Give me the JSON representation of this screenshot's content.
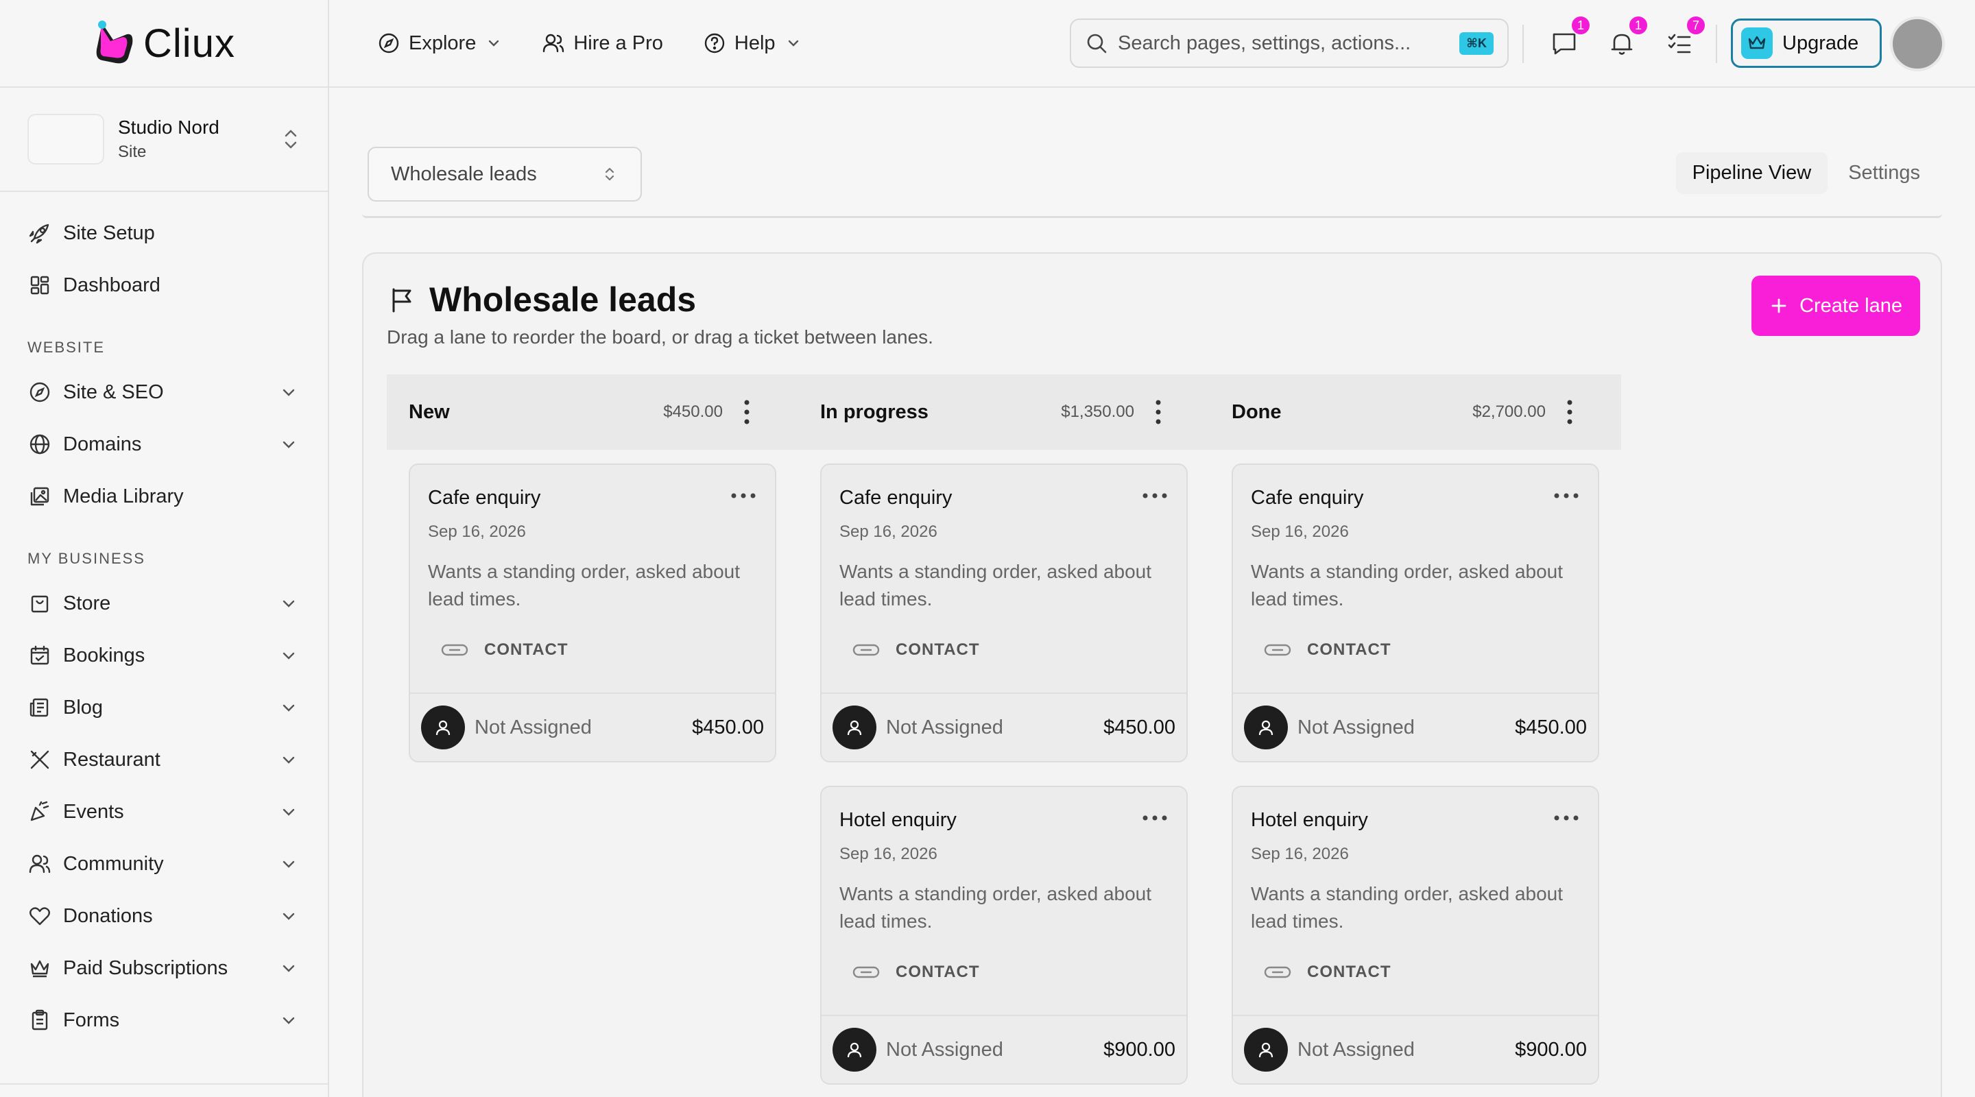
{
  "app": {
    "name": "Cliux"
  },
  "site": {
    "name": "Studio Nord",
    "type": "Site"
  },
  "sidebar": {
    "top_items": [
      {
        "label": "Site Setup",
        "icon": "rocket-icon"
      },
      {
        "label": "Dashboard",
        "icon": "dashboard-icon"
      }
    ],
    "sections": [
      {
        "title": "WEBSITE",
        "items": [
          {
            "label": "Site & SEO",
            "icon": "compass-icon"
          },
          {
            "label": "Domains",
            "icon": "globe-icon"
          },
          {
            "label": "Media Library",
            "icon": "media-icon"
          }
        ]
      },
      {
        "title": "MY BUSINESS",
        "items": [
          {
            "label": "Store",
            "icon": "store-icon"
          },
          {
            "label": "Bookings",
            "icon": "calendar-icon"
          },
          {
            "label": "Blog",
            "icon": "blog-icon"
          },
          {
            "label": "Restaurant",
            "icon": "utensils-icon"
          },
          {
            "label": "Events",
            "icon": "party-icon"
          },
          {
            "label": "Community",
            "icon": "users-icon"
          },
          {
            "label": "Donations",
            "icon": "heart-icon"
          },
          {
            "label": "Paid Subscriptions",
            "icon": "crown-icon"
          },
          {
            "label": "Forms",
            "icon": "clipboard-icon"
          }
        ]
      }
    ]
  },
  "header": {
    "nav": [
      {
        "label": "Explore",
        "icon": "compass-icon",
        "dropdown": true
      },
      {
        "label": "Hire a Pro",
        "icon": "users-icon",
        "dropdown": false
      },
      {
        "label": "Help",
        "icon": "help-icon",
        "dropdown": true
      }
    ],
    "search": {
      "placeholder": "Search pages, settings, actions...",
      "shortcut": "⌘K"
    },
    "badges": {
      "messages": "1",
      "notifications": "1",
      "tasks": "7"
    },
    "upgrade_label": "Upgrade"
  },
  "board": {
    "selected": "Wholesale leads",
    "tabs": [
      "Pipeline View",
      "Settings"
    ],
    "active_tab": "Pipeline View",
    "title": "Wholesale leads",
    "subtitle": "Drag a lane to reorder the board, or drag a ticket between lanes.",
    "create_label": "Create lane",
    "lanes": [
      {
        "name": "New",
        "total": "$450.00",
        "cards": [
          {
            "title": "Cafe enquiry",
            "date": "Sep 16, 2026",
            "desc": "Wants a standing order, asked about lead times.",
            "tag": "CONTACT",
            "assignee": "Not Assigned",
            "amount": "$450.00"
          }
        ]
      },
      {
        "name": "In progress",
        "total": "$1,350.00",
        "cards": [
          {
            "title": "Cafe enquiry",
            "date": "Sep 16, 2026",
            "desc": "Wants a standing order, asked about lead times.",
            "tag": "CONTACT",
            "assignee": "Not Assigned",
            "amount": "$450.00"
          },
          {
            "title": "Hotel enquiry",
            "date": "Sep 16, 2026",
            "desc": "Wants a standing order, asked about lead times.",
            "tag": "CONTACT",
            "assignee": "Not Assigned",
            "amount": "$900.00"
          }
        ]
      },
      {
        "name": "Done",
        "total": "$2,700.00",
        "cards": [
          {
            "title": "Cafe enquiry",
            "date": "Sep 16, 2026",
            "desc": "Wants a standing order, asked about lead times.",
            "tag": "CONTACT",
            "assignee": "Not Assigned",
            "amount": "$450.00"
          },
          {
            "title": "Hotel enquiry",
            "date": "Sep 16, 2026",
            "desc": "Wants a standing order, asked about lead times.",
            "tag": "CONTACT",
            "assignee": "Not Assigned",
            "amount": "$900.00"
          }
        ]
      }
    ]
  },
  "colors": {
    "accent": "#f91ed8",
    "badge": "#f21bd6",
    "brand_cyan": "#2ec7e6",
    "upgrade_border": "#1a7fa3"
  }
}
